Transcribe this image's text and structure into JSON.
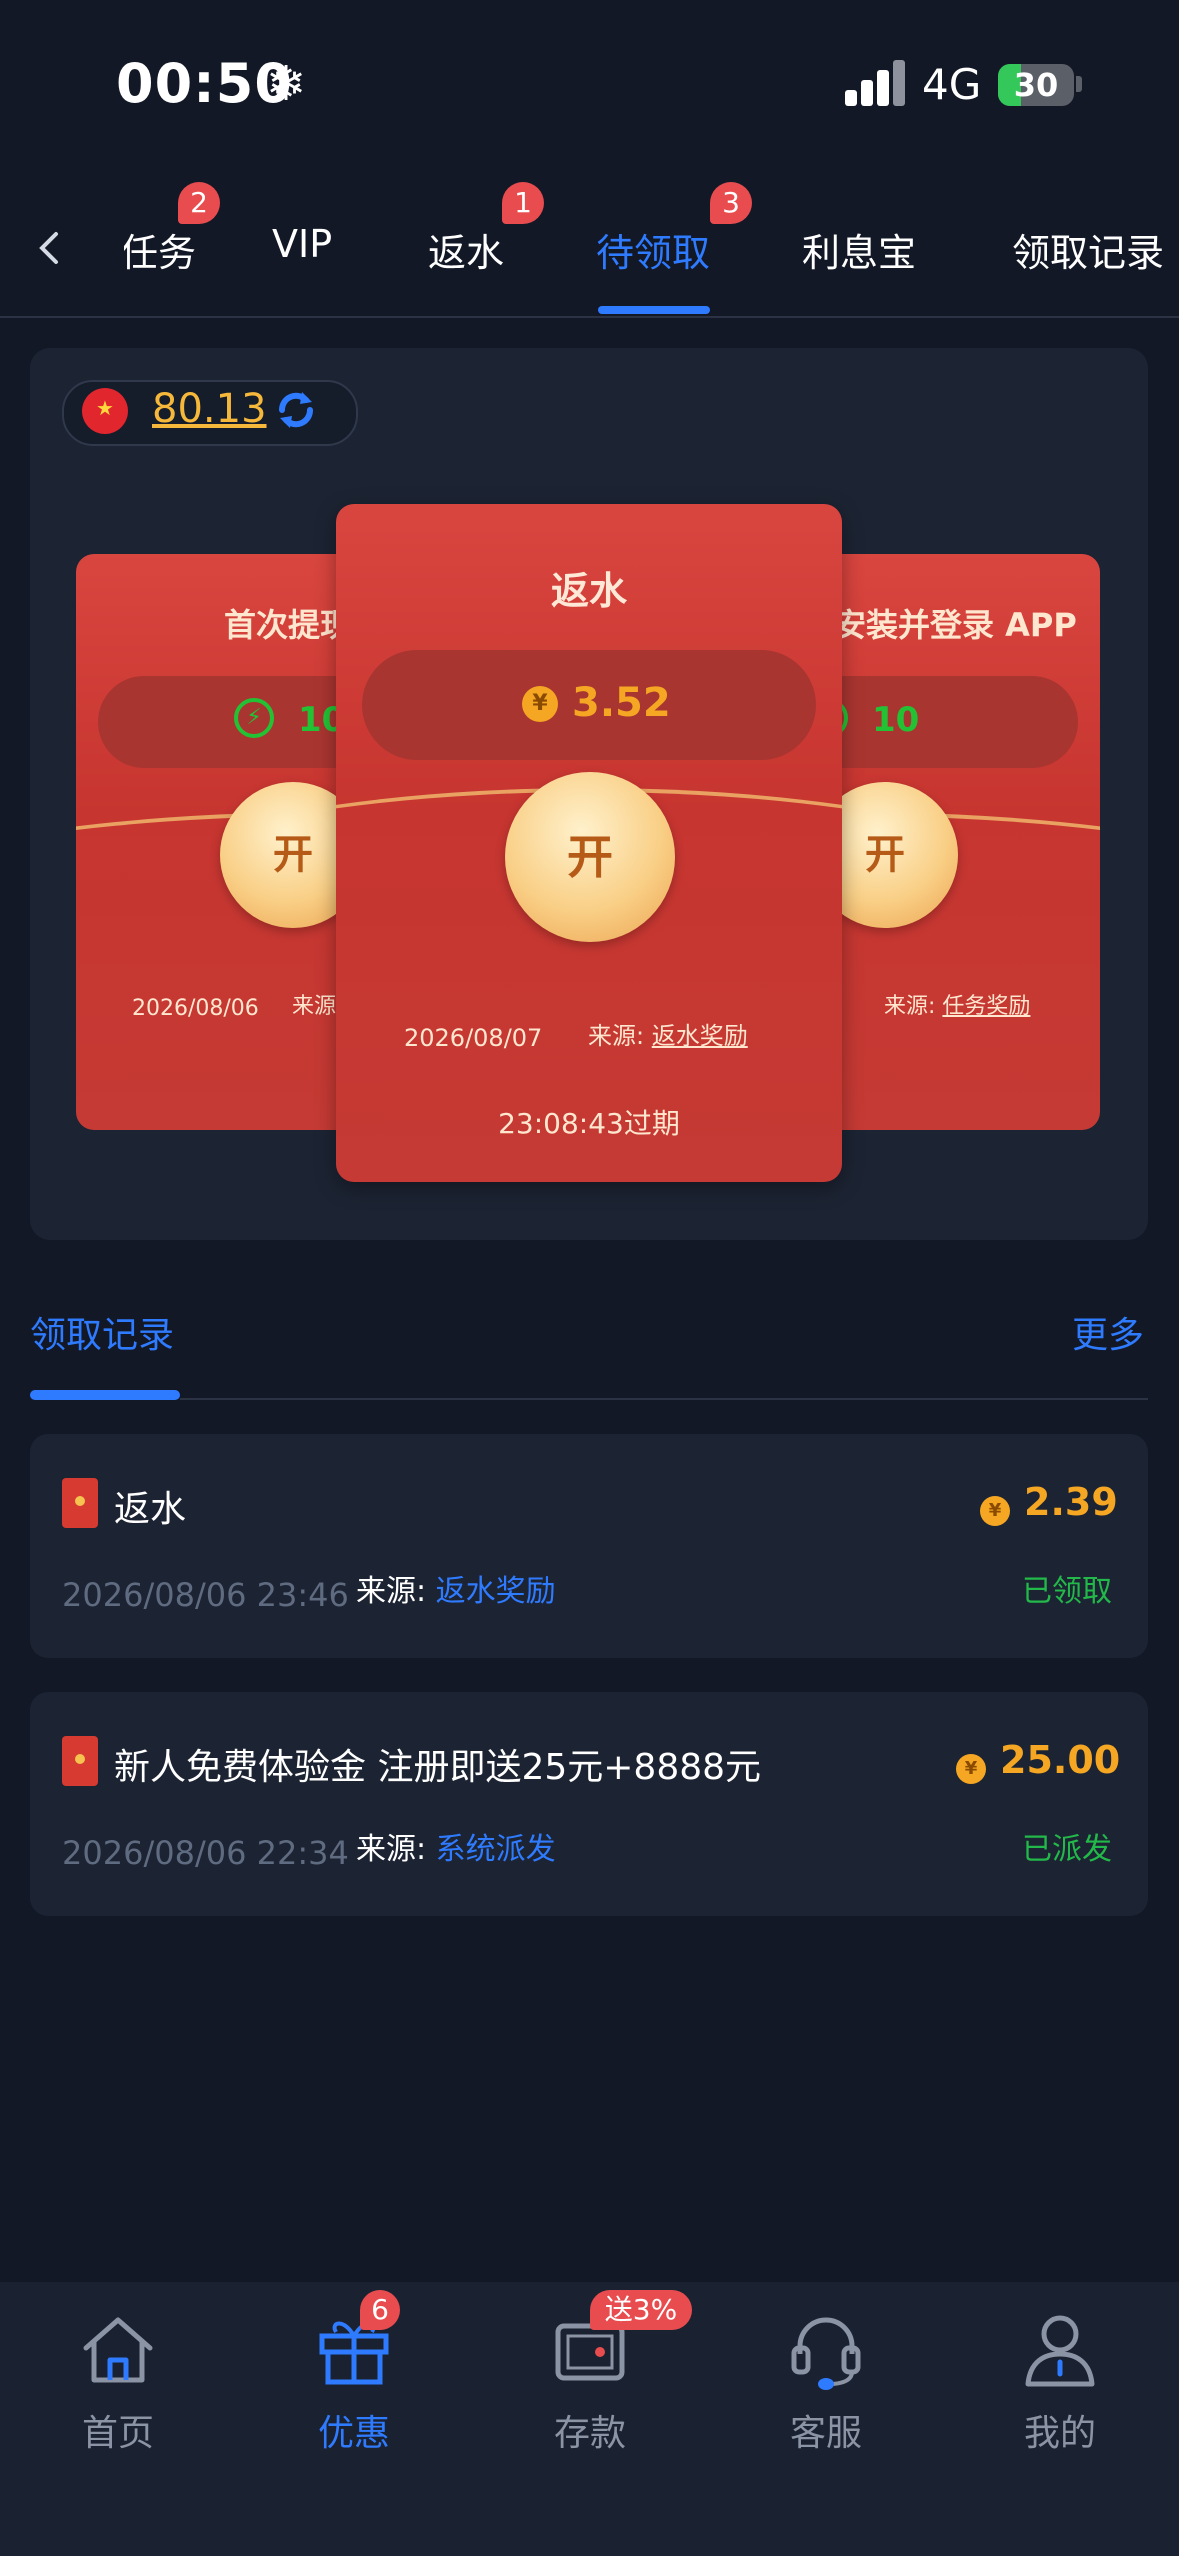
{
  "status_bar": {
    "time": "00:50",
    "network": "4G",
    "battery": "30",
    "battery_level": 0.3
  },
  "tabs": {
    "items": [
      {
        "label": "任务",
        "badge": "2",
        "active": false
      },
      {
        "label": "VIP",
        "badge": "",
        "active": false
      },
      {
        "label": "返水",
        "badge": "1",
        "active": false
      },
      {
        "label": "待领取",
        "badge": "3",
        "active": true
      },
      {
        "label": "利息宝",
        "badge": "",
        "active": false
      },
      {
        "label": "领取记录",
        "badge": "",
        "active": false
      }
    ]
  },
  "balance": {
    "value": "80.13"
  },
  "envelopes": {
    "left": {
      "title": "首次提现",
      "amount": "10",
      "open_label": "开",
      "date": "2026/08/06",
      "source_label": "来源"
    },
    "center": {
      "title": "返水",
      "amount": "3.52",
      "open_label": "开",
      "date": "2026/08/07",
      "source_label": "来源:",
      "source_value": "返水奖励",
      "expiry": "23:08:43过期"
    },
    "right": {
      "title": "安装并登录 APP",
      "amount": "10",
      "open_label": "开",
      "source_label": "来源:",
      "source_value": "任务奖励"
    }
  },
  "records": {
    "title": "领取记录",
    "more": "更多",
    "items": [
      {
        "title": "返水",
        "date": "2026/08/06 23:46",
        "source_label": "来源:",
        "source_value": "返水奖励",
        "amount": "2.39",
        "status": "已领取"
      },
      {
        "title": "新人免费体验金 注册即送25元+8888元",
        "date": "2026/08/06 22:34",
        "source_label": "来源:",
        "source_value": "系统派发",
        "amount": "25.00",
        "status": "已派发"
      }
    ]
  },
  "bottom_nav": {
    "items": [
      {
        "label": "首页",
        "icon": "home-icon",
        "badge": "",
        "active": false
      },
      {
        "label": "优惠",
        "icon": "gift-icon",
        "badge": "6",
        "active": true
      },
      {
        "label": "存款",
        "icon": "wallet-icon",
        "badge": "送3%",
        "active": false
      },
      {
        "label": "客服",
        "icon": "headset-icon",
        "badge": "",
        "active": false
      },
      {
        "label": "我的",
        "icon": "user-icon",
        "badge": "",
        "active": false
      }
    ]
  },
  "coin_symbol": "¥",
  "colors": {
    "accent": "#2f7bff",
    "gold": "#f5a623",
    "green": "#22b94a",
    "envelope_red": "#d9453f",
    "badge_red": "#e84c4f"
  }
}
